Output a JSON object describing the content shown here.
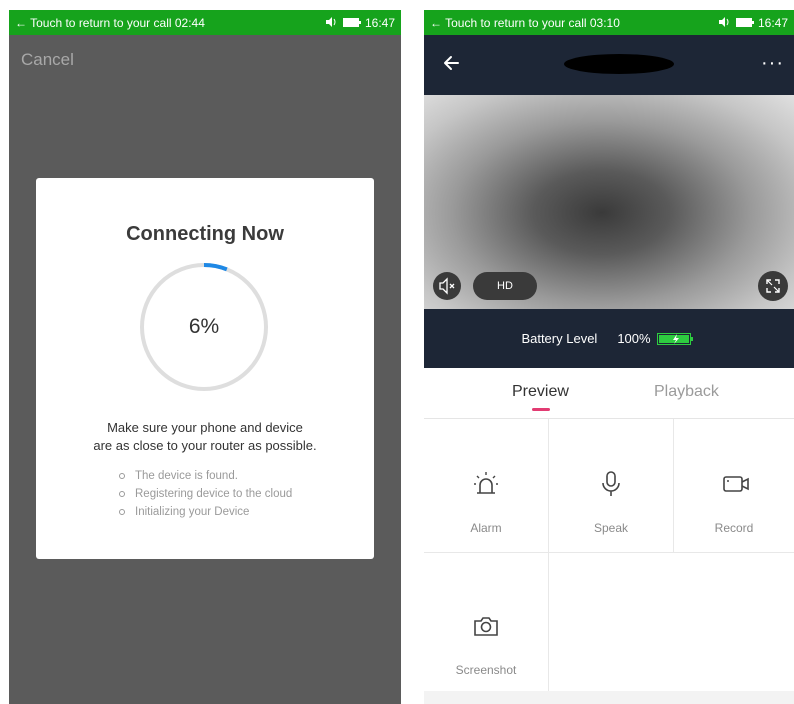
{
  "left_screen": {
    "status_bar": {
      "call_text": "← Touch to return to your call 02:44",
      "time": "16:47"
    },
    "cancel_label": "Cancel",
    "dialog": {
      "title": "Connecting Now",
      "progress": 0.06,
      "progress_text": "6%",
      "hint_line1": "Make sure your phone and device",
      "hint_line2": "are as close to your router as possible.",
      "steps": [
        "The device is found.",
        "Registering device to the cloud",
        "Initializing your Device"
      ]
    }
  },
  "right_screen": {
    "status_bar": {
      "call_text": "← Touch to return to your call 03:10",
      "time": "16:47"
    },
    "more_label": "···",
    "video_controls": {
      "hd_label": "HD"
    },
    "battery": {
      "label": "Battery Level",
      "value": "100%"
    },
    "tabs": {
      "preview": "Preview",
      "playback": "Playback"
    },
    "actions": {
      "alarm": "Alarm",
      "speak": "Speak",
      "record": "Record",
      "screenshot": "Screenshot"
    }
  },
  "colors": {
    "status_green": "#16a31c",
    "dark_navy": "#1d2636",
    "progress_blue": "#1e88e5",
    "tab_accent": "#e23b72",
    "battery_green": "#2ecc40"
  },
  "icons": [
    "back-arrow-icon",
    "more-icon",
    "mute-icon",
    "fullscreen-icon",
    "battery-icon",
    "alarm-icon",
    "microphone-icon",
    "video-camera-icon",
    "camera-icon",
    "volume-icon"
  ]
}
